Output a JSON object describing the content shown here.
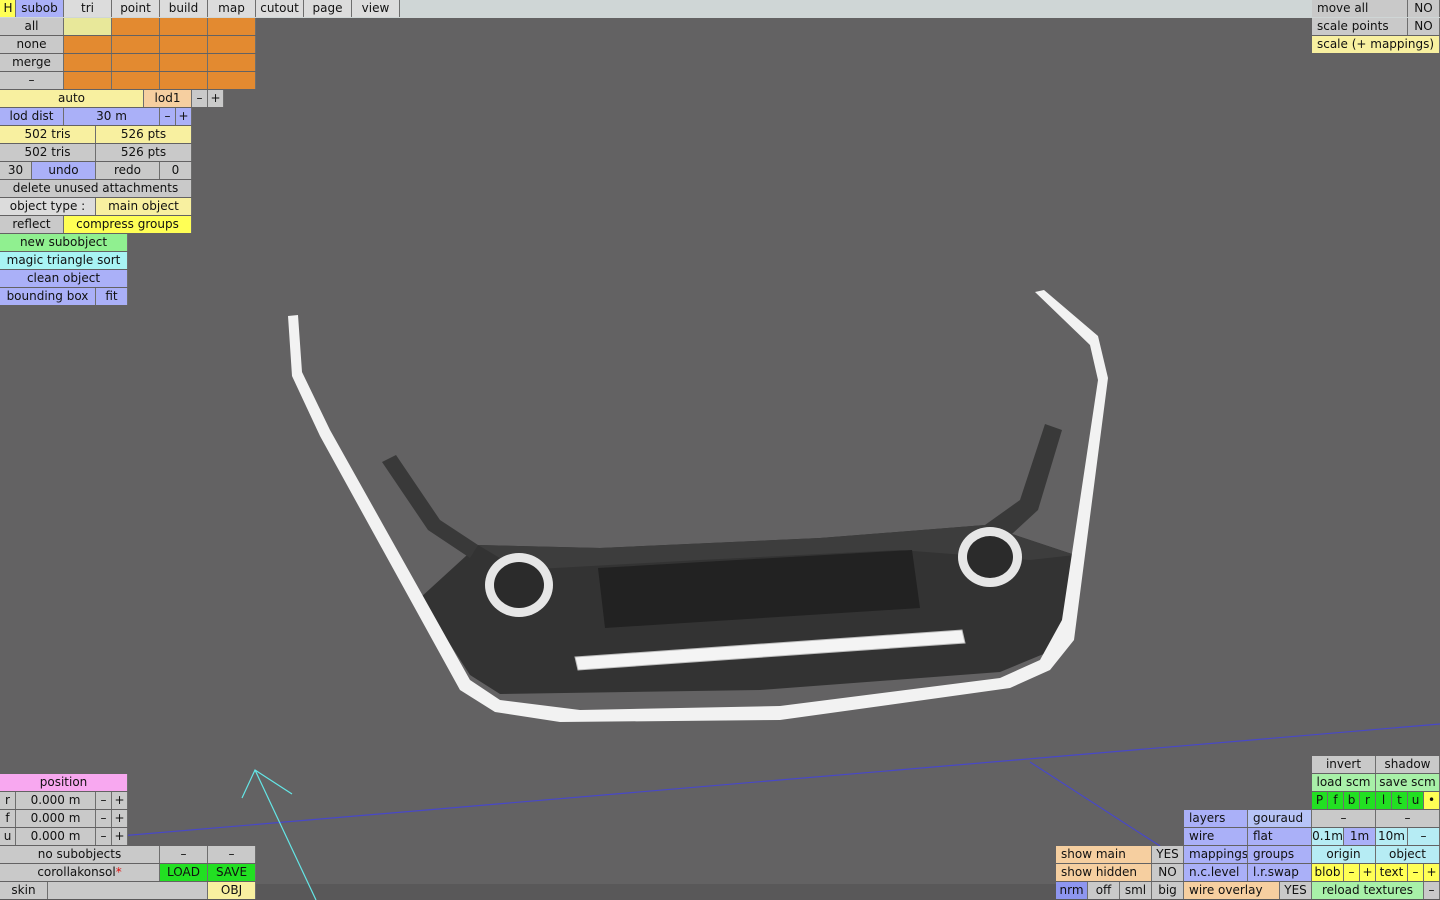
{
  "menu": {
    "h": "H",
    "tabs": [
      "subob",
      "tri",
      "point",
      "build",
      "map",
      "cutout",
      "page",
      "view"
    ]
  },
  "subob_panel": {
    "all": "all",
    "none": "none",
    "merge": "merge",
    "dash": "–"
  },
  "lod": {
    "auto": "auto",
    "lod1": "lod1",
    "minus": "–",
    "plus": "+",
    "lod_dist_label": "lod dist",
    "lod_dist_value": "30 m"
  },
  "stats": {
    "tris1": "502 tris",
    "pts1": "526 pts",
    "tris2": "502 tris",
    "pts2": "526 pts"
  },
  "history": {
    "undo_count": "30",
    "undo": "undo",
    "redo": "redo",
    "redo_count": "0"
  },
  "actions": {
    "delete_unused": "delete unused attachments",
    "object_type_label": "object type :",
    "object_type_value": "main object",
    "reflect": "reflect",
    "compress_groups": "compress groups",
    "new_subobject": "new subobject",
    "magic_triangle_sort": "magic triangle sort",
    "clean_object": "clean object",
    "bounding_box": "bounding box",
    "fit": "fit"
  },
  "top_right": {
    "move_all": "move all",
    "move_all_val": "NO",
    "scale_points": "scale points",
    "scale_points_val": "NO",
    "scale_mappings": "scale (+ mappings)"
  },
  "position": {
    "title": "position",
    "rows": [
      {
        "axis": "r",
        "value": "0.000 m"
      },
      {
        "axis": "f",
        "value": "0.000 m"
      },
      {
        "axis": "u",
        "value": "0.000 m"
      }
    ],
    "minus": "–",
    "plus": "+"
  },
  "bottom_left": {
    "no_subobjects": "no subobjects",
    "dash1": "–",
    "dash2": "–",
    "filename": "corollakonsol",
    "modified_mark": "*",
    "load": "LOAD",
    "save": "SAVE",
    "skin": "skin",
    "obj": "OBJ"
  },
  "bottom_right": {
    "invert": "invert",
    "shadow": "shadow",
    "load_scm": "load scm",
    "save_scm": "save scm",
    "view_keys": [
      "P",
      "f",
      "b",
      "r",
      "l",
      "t",
      "u",
      "•"
    ],
    "dash_a": "–",
    "dash_b": "–",
    "layers": "layers",
    "gouraud": "gouraud",
    "wire": "wire",
    "flat": "flat",
    "mappings": "mappings",
    "groups": "groups",
    "nclevel": "n.c.level",
    "lrswap": "l.r.swap",
    "scale_01": "0.1m",
    "scale_1": "1m",
    "scale_10": "10m",
    "scale_dash": "–",
    "origin": "origin",
    "object": "object",
    "blob": "blob",
    "blob_minus": "–",
    "blob_plus": "+",
    "text": "text",
    "text_minus": "–",
    "text_plus": "+",
    "reload_textures": "reload textures",
    "reload_dash": "–",
    "show_main": "show main",
    "show_main_val": "YES",
    "show_hidden": "show hidden",
    "show_hidden_val": "NO",
    "nrm": "nrm",
    "off": "off",
    "sml": "sml",
    "big": "big",
    "wire_overlay": "wire overlay",
    "wire_overlay_val": "YES"
  },
  "colors": {
    "background": "#636263",
    "model_body": "#2e2e2e",
    "model_trim": "#f2f2f2"
  }
}
